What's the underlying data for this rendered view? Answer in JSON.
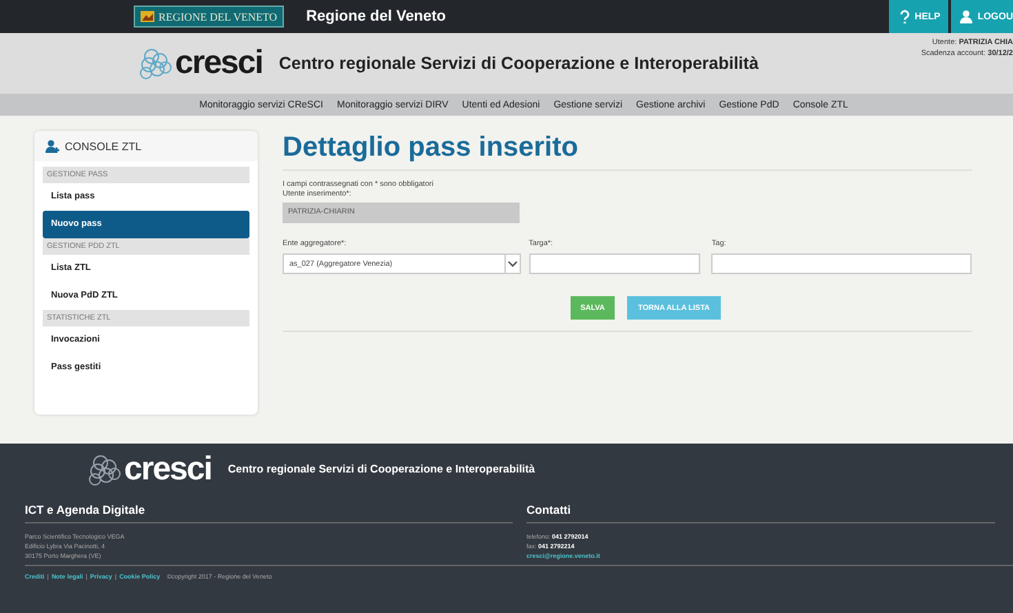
{
  "top_bar": {
    "brand_badge": "REGIONE DEL VENETO",
    "site_name": "Regione del Veneto",
    "buttons": [
      {
        "label": "HELP",
        "kind": "help"
      },
      {
        "label": "LOGOU",
        "kind": "logout"
      }
    ]
  },
  "header": {
    "logo_text": "cresci",
    "title": "Centro regionale Servizi di Cooperazione e Interoperabilità",
    "user_label": "Utente:",
    "user_value": "PATRIZIA CHIA",
    "expiry_label": "Scadenza account:",
    "expiry_value": "30/12/2"
  },
  "nav": [
    "Monitoraggio servizi CReSCI",
    "Monitoraggio servizi DIRV",
    "Utenti ed Adesioni",
    "Gestione servizi",
    "Gestione archivi",
    "Gestione PdD",
    "Console ZTL"
  ],
  "sidebar": {
    "title": "CONSOLE ZTL",
    "groups": [
      {
        "heading": "GESTIONE PASS",
        "items": [
          {
            "label": "Lista pass",
            "selected": false
          },
          {
            "label": "Nuovo pass",
            "selected": true
          }
        ]
      },
      {
        "heading": "GESTIONE PDD ZTL",
        "items": [
          {
            "label": "Lista ZTL",
            "selected": false
          },
          {
            "label": "Nuova PdD ZTL",
            "selected": false
          }
        ]
      },
      {
        "heading": "STATISTICHE ZTL",
        "items": [
          {
            "label": "Invocazioni",
            "selected": false
          },
          {
            "label": "Pass gestiti",
            "selected": false
          }
        ]
      }
    ]
  },
  "form": {
    "title": "Dettaglio pass inserito",
    "note": "I campi contrassegnati con * sono obbligatori",
    "readonly_field": {
      "label": "Utente inserimento*:",
      "value": "PATRIZIA-CHIARIN"
    },
    "fields": [
      {
        "kind": "select",
        "label": "Ente aggregatore*:",
        "value": "as_027 (Aggregatore Venezia)"
      },
      {
        "kind": "text",
        "label": "Targa*:"
      },
      {
        "kind": "text",
        "label": "Tag:"
      }
    ],
    "buttons": [
      {
        "label": "SALVA",
        "kind": "success"
      },
      {
        "label": "TORNA ALLA LISTA",
        "kind": "info"
      }
    ]
  },
  "footer": {
    "logo_text": "cresci",
    "title": "Centro regionale Servizi di Cooperazione e Interoperabilità",
    "columns": [
      {
        "heading": "ICT e Agenda Digitale",
        "lines": [
          {
            "kind": "text",
            "text": "Parco Scientifico Tecnologico VEGA"
          },
          {
            "kind": "text",
            "text": "Edificio Lybra Via Pacinotti, 4"
          },
          {
            "kind": "text",
            "text": "30175 Porto Marghera (VE)"
          }
        ]
      },
      {
        "heading": "Contatti",
        "lines": [
          {
            "kind": "text",
            "text": "telefono: **041 2792014**"
          },
          {
            "kind": "text",
            "text": "fax: **041 2792214**"
          },
          {
            "kind": "link",
            "text": "cresci@regione.veneto.it"
          }
        ]
      }
    ],
    "links": [
      "Crediti",
      "Note legali",
      "Privacy",
      "Cookie Policy"
    ],
    "separator": "|",
    "copyright": "©copyright 2017 - Regione del Veneto"
  }
}
